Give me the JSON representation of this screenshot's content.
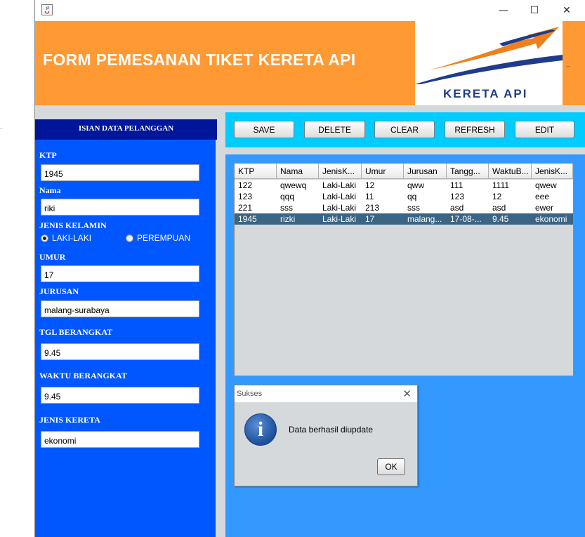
{
  "window": {
    "controls": {
      "minimize": "—",
      "maximize": "☐",
      "close": "✕"
    }
  },
  "banner": {
    "title": "FORM PEMESANAN TIKET KERETA API",
    "logo_text": "KERETA API",
    "stray_dots": ".."
  },
  "colors": {
    "banner": "#ff9933",
    "left_panel": "#0057ff",
    "left_header": "#00169a",
    "button_bar": "#00ccff",
    "right_panel": "#3399ff",
    "selected_row": "#3a6585",
    "logo_blue": "#1f3c8c",
    "logo_orange": "#f07f1d"
  },
  "form": {
    "header": "ISIAN DATA PELANGGAN",
    "ktp_label": "KTP",
    "ktp_value": "1945",
    "nama_label": "Nama",
    "nama_value": "riki",
    "jenis_kelamin_label": "JENIS KELAMIN",
    "radio_laki": "LAKI-LAKI",
    "radio_perempuan": "PEREMPUAN",
    "umur_label": "UMUR",
    "umur_value": "17",
    "jurusan_label": "JURUSAN",
    "jurusan_value": "malang-surabaya",
    "tgl_label": "TGL BERANGKAT",
    "tgl_value": "9.45",
    "waktu_label": "WAKTU BERANGKAT",
    "waktu_value": "9.45",
    "kereta_label": "JENIS KERETA",
    "kereta_value": "ekonomi"
  },
  "toolbar": {
    "save": "SAVE",
    "delete": "DELETE",
    "clear": "CLEAR",
    "refresh": "REFRESH",
    "edit": "EDIT"
  },
  "table": {
    "columns": [
      "KTP",
      "Nama",
      "JenisK...",
      "Umur",
      "Jurusan",
      "Tangg...",
      "WaktuB...",
      "JenisK..."
    ],
    "rows": [
      [
        "122",
        "qwewq",
        "Laki-Laki",
        "12",
        "qww",
        "111",
        "1111",
        "qwew"
      ],
      [
        "123",
        "qqq",
        "Laki-Laki",
        "11",
        "qq",
        "123",
        "12",
        "eee"
      ],
      [
        "221",
        "sss",
        "Laki-Laki",
        "213",
        "sss",
        "asd",
        "asd",
        "ewer"
      ],
      [
        "1945",
        "rizki",
        "Laki-Laki",
        "17",
        "malang...",
        "17-08-...",
        "9.45",
        "ekonomi"
      ]
    ],
    "selected_row": 3
  },
  "dialog": {
    "title": "Sukses",
    "close": "✕",
    "icon": "info-icon",
    "icon_glyph": "i",
    "message": "Data berhasil diupdate",
    "ok": "OK"
  },
  "stray_dot": "."
}
